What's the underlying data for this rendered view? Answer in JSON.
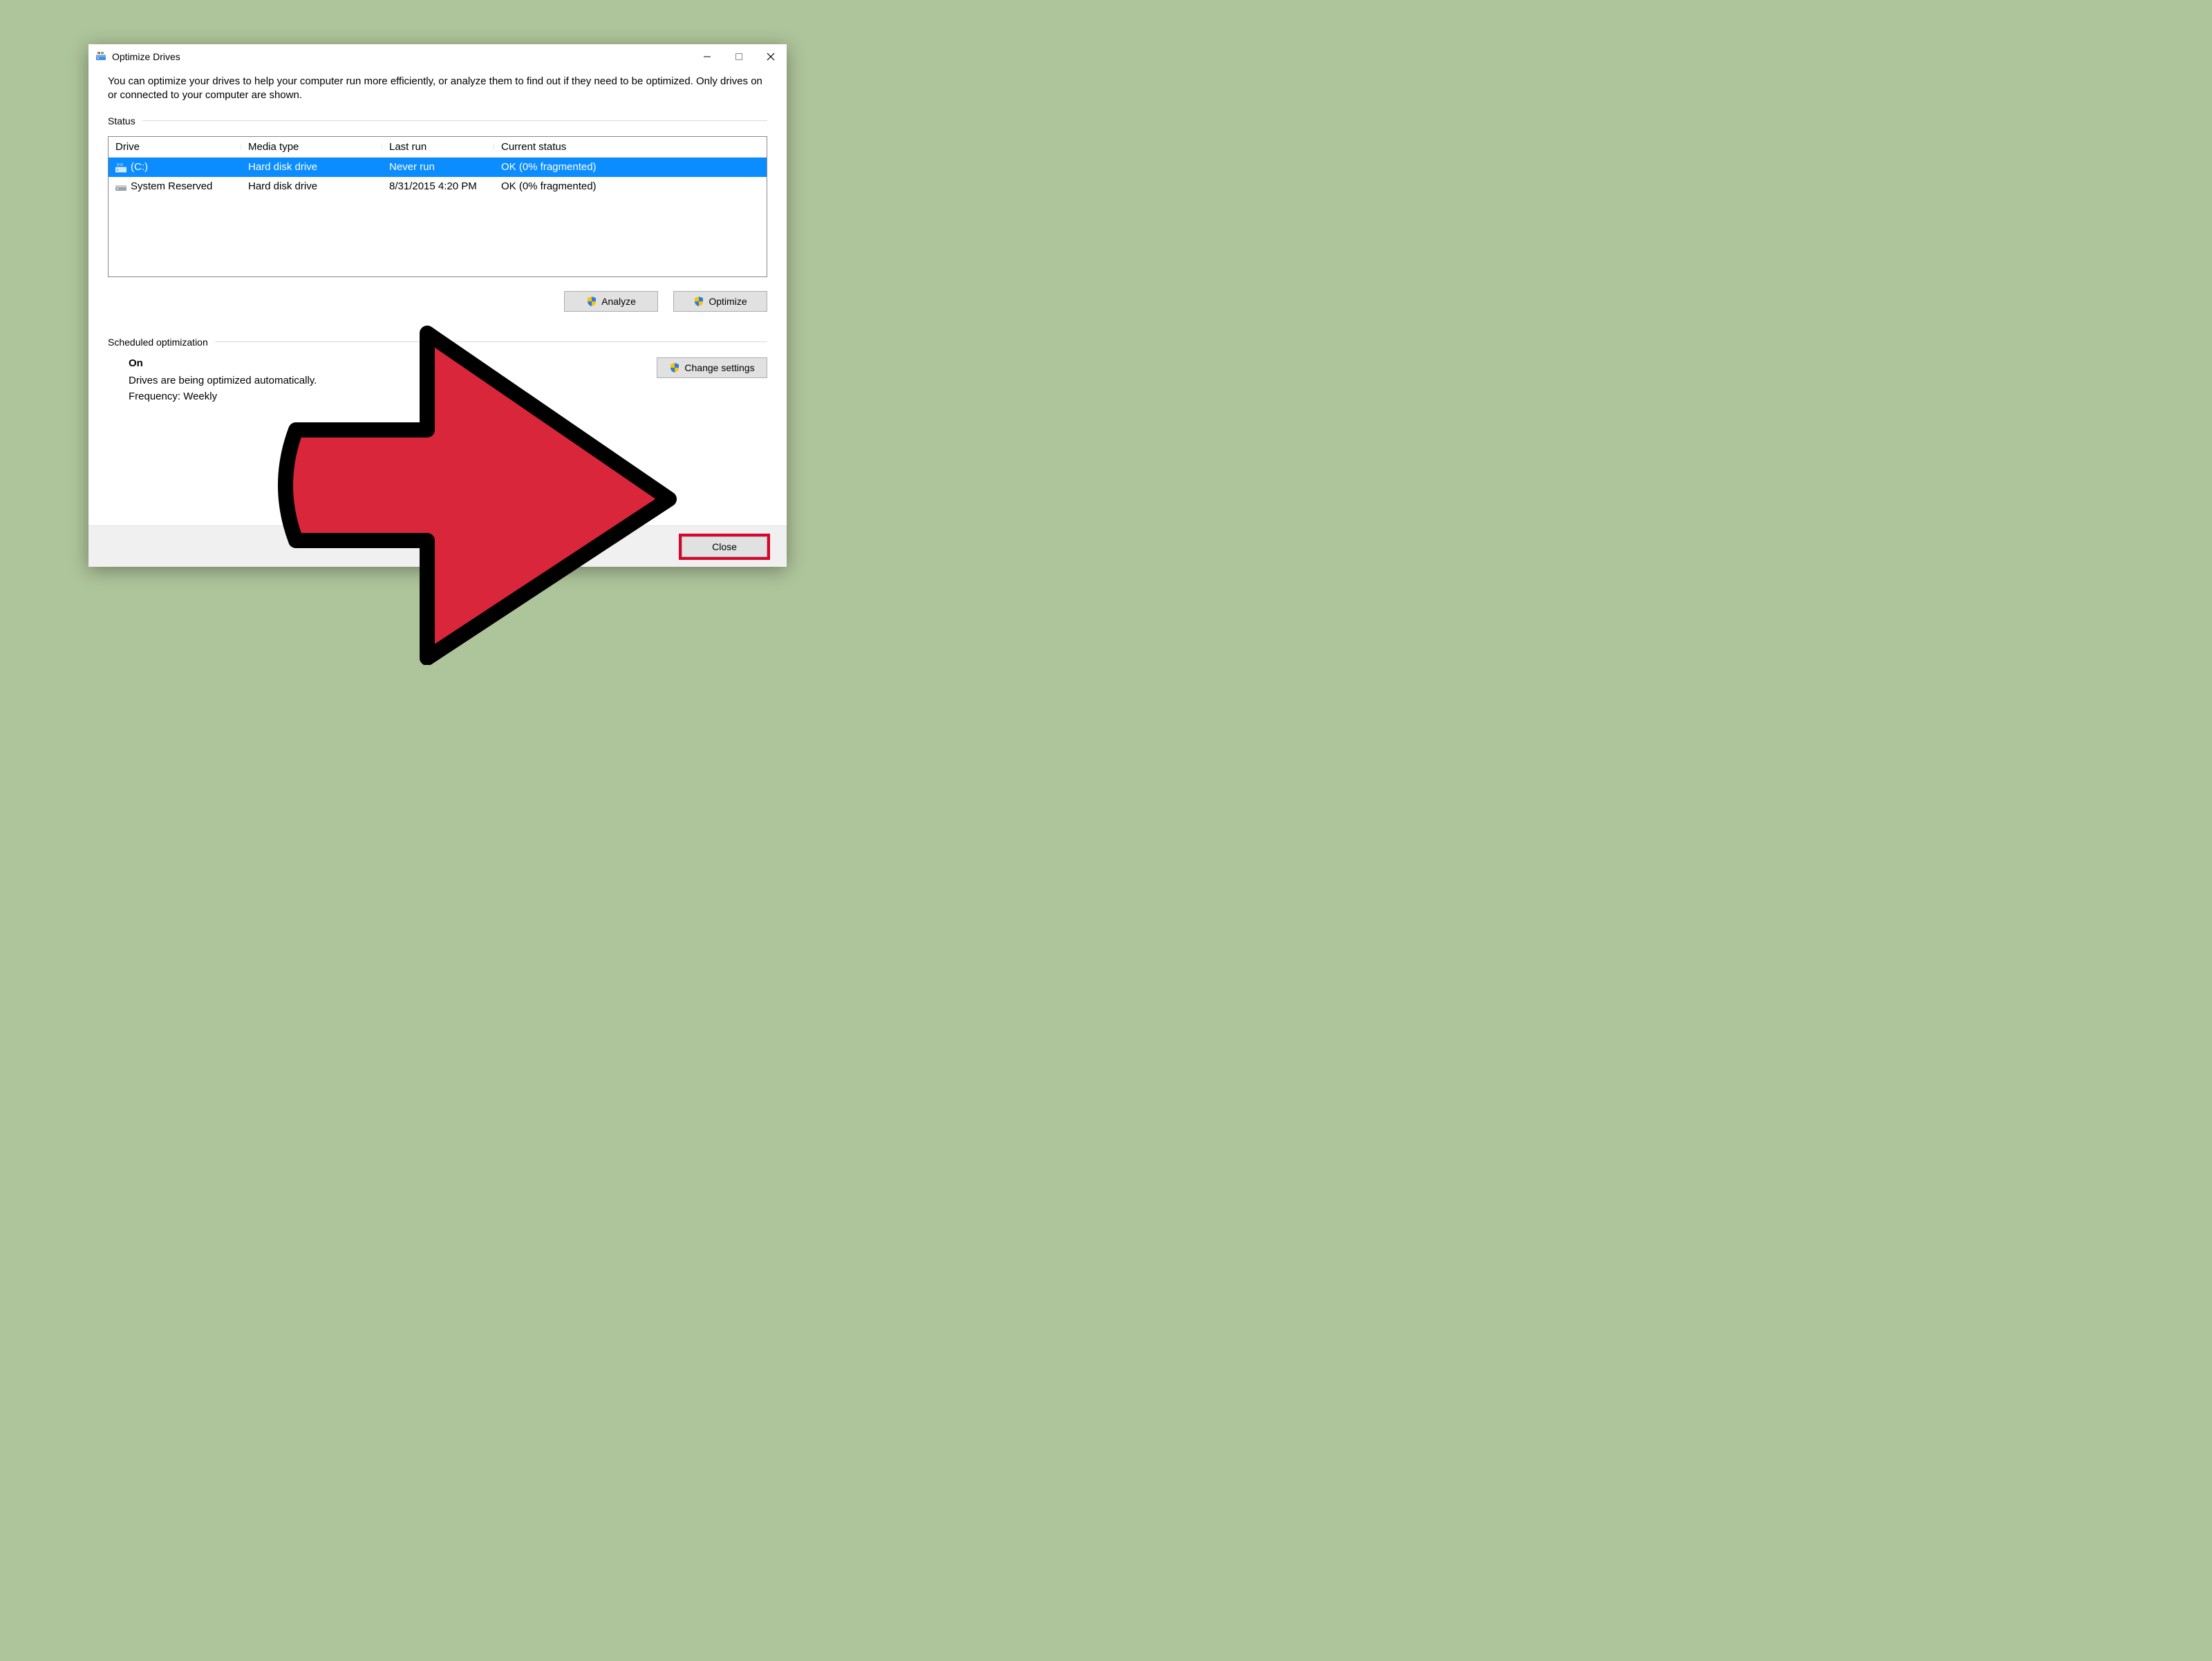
{
  "window": {
    "title": "Optimize Drives",
    "description": "You can optimize your drives to help your computer run more efficiently, or analyze them to find out if they need to be optimized. Only drives on or connected to your computer are shown."
  },
  "status": {
    "label": "Status",
    "columns": {
      "drive": "Drive",
      "media": "Media type",
      "last": "Last run",
      "status": "Current status"
    },
    "rows": [
      {
        "drive": "(C:)",
        "media": "Hard disk drive",
        "last": "Never run",
        "status": "OK (0% fragmented)",
        "selected": true,
        "icon": "os-drive"
      },
      {
        "drive": "System Reserved",
        "media": "Hard disk drive",
        "last": "8/31/2015 4:20 PM",
        "status": "OK (0% fragmented)",
        "selected": false,
        "icon": "drive"
      }
    ]
  },
  "buttons": {
    "analyze": "Analyze",
    "optimize": "Optimize",
    "change_settings": "Change settings",
    "close": "Close"
  },
  "scheduled": {
    "label": "Scheduled optimization",
    "on_label": "On",
    "auto_line": "Drives are being optimized automatically.",
    "frequency_line": "Frequency: Weekly"
  },
  "annotation": {
    "arrow_target": "close-button",
    "highlight_color": "#d9042b"
  }
}
